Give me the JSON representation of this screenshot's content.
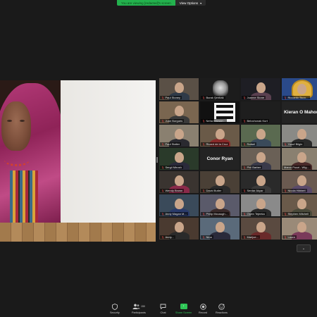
{
  "banner": {
    "share_text": "You are viewing [redacted]'s screen",
    "view_options": "View Options"
  },
  "gallery": {
    "tiles": [
      {
        "name": "Paul Stoney",
        "muted": true,
        "kind": "person",
        "bg": "#5a5046",
        "shirt": "#2f3a48"
      },
      {
        "name": "Burak Şenbak",
        "muted": true,
        "kind": "dog",
        "bg": "#1c1c1c"
      },
      {
        "name": "Joanne Stone",
        "muted": true,
        "kind": "person",
        "bg": "#1e1e24",
        "shirt": "#5a4050"
      },
      {
        "name": "Riccardo Bucc...",
        "muted": true,
        "kind": "badge",
        "bg": "#2a4a8a"
      },
      {
        "name": "Juan Burgues",
        "muted": true,
        "kind": "person",
        "bg": "#7a6650",
        "shirt": "#3a3a3a"
      },
      {
        "name": "Neha Bhusan...",
        "muted": true,
        "kind": "poster",
        "bg": "#111111"
      },
      {
        "name": "Belochonak Kurt",
        "muted": true,
        "kind": "empty",
        "bg": "#1e1e1e"
      },
      {
        "name": "",
        "muted": false,
        "kind": "label",
        "label": "Kieran O Mahon",
        "bg": "#232323"
      },
      {
        "name": "Paul Stalter",
        "muted": true,
        "kind": "person",
        "bg": "#8a8070",
        "shirt": "#2a2a30"
      },
      {
        "name": "Ricard de la Cruz",
        "muted": true,
        "kind": "person",
        "bg": "#6a5a48",
        "shirt": "#8a2a2a"
      },
      {
        "name": "Rafael",
        "muted": true,
        "kind": "person",
        "bg": "#5a6a50",
        "shirt": "#3a4a5a"
      },
      {
        "name": "Yusuf Bilgin",
        "muted": true,
        "kind": "person",
        "bg": "#8a8a86",
        "shirt": "#2a2a2a"
      },
      {
        "name": "Sergii Mirosh",
        "muted": true,
        "kind": "person",
        "bg": "#2a3a2a",
        "shirt": "#2a2a3a"
      },
      {
        "name": "",
        "muted": false,
        "kind": "label",
        "label": "Conor Ryan",
        "bg": "#232323"
      },
      {
        "name": "Phil Barber",
        "muted": true,
        "kind": "person",
        "bg": "#6a6056",
        "shirt": "#3a3a4a"
      },
      {
        "name": "Marco Pozzi - Wig...",
        "muted": false,
        "kind": "person",
        "bg": "#8a8070",
        "shirt": "#4a2a2a",
        "active": true
      },
      {
        "name": "Wendy Brown",
        "muted": true,
        "kind": "person",
        "bg": "#3a3430",
        "shirt": "#8a2a4a"
      },
      {
        "name": "David Butler",
        "muted": true,
        "kind": "person",
        "bg": "#4a4036",
        "shirt": "#2a2a2a"
      },
      {
        "name": "Serdar Akyar",
        "muted": true,
        "kind": "person",
        "bg": "#2a2a2a",
        "shirt": "#3a3a3a"
      },
      {
        "name": "Nicola Hibbert",
        "muted": true,
        "kind": "person",
        "bg": "#6a5a50",
        "shirt": "#5a4a6a"
      },
      {
        "name": "Andy Magan M...",
        "muted": true,
        "kind": "person",
        "bg": "#3a4a5a",
        "shirt": "#2a3a6a"
      },
      {
        "name": "Philip Mccaugh...",
        "muted": true,
        "kind": "person",
        "bg": "#5a5a6a",
        "shirt": "#3a2a2a"
      },
      {
        "name": "Owen Tejeeka",
        "muted": true,
        "kind": "person",
        "bg": "#8a8a8a",
        "shirt": "#2a2a2a"
      },
      {
        "name": "Stephen Mitchell",
        "muted": true,
        "kind": "person",
        "bg": "#6a5a4a",
        "shirt": "#4a4a3a"
      },
      {
        "name": "Andy...",
        "muted": true,
        "kind": "person",
        "bg": "#4a3a30",
        "shirt": "#2a2a2a"
      },
      {
        "name": "Nina",
        "muted": true,
        "kind": "person",
        "bg": "#5a6a7a",
        "shirt": "#2a2a3a"
      },
      {
        "name": "Marijoe...",
        "muted": true,
        "kind": "person",
        "bg": "#5a4a40",
        "shirt": "#6a2a2a"
      },
      {
        "name": "Laura",
        "muted": true,
        "kind": "person",
        "bg": "#9a8a78",
        "shirt": "#7a3a5a"
      }
    ]
  },
  "toolbar": {
    "items": [
      {
        "label": "Security",
        "icon": "shield-icon"
      },
      {
        "label": "Participants",
        "icon": "participants-icon",
        "count": "150"
      },
      {
        "label": "Chat",
        "icon": "chat-icon"
      },
      {
        "label": "Share Screen",
        "icon": "share-screen-icon"
      },
      {
        "label": "Record",
        "icon": "record-icon"
      },
      {
        "label": "Reactions",
        "icon": "reactions-icon"
      }
    ]
  },
  "colors": {
    "share_green": "#2ec556",
    "banner_green": "#23b14d",
    "active_speaker": "#c7e34a",
    "muted_red": "#e04848"
  }
}
